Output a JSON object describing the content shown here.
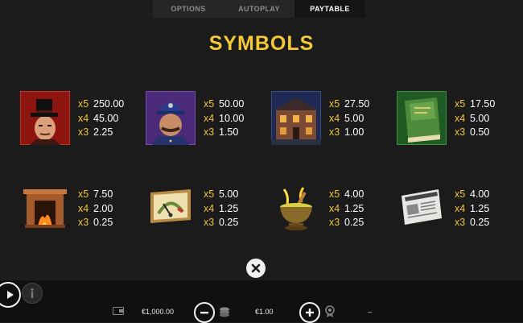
{
  "tabs": [
    {
      "label": "OPTIONS"
    },
    {
      "label": "AUTOPLAY"
    },
    {
      "label": "PAYTABLE"
    }
  ],
  "paytable": {
    "title": "SYMBOLS",
    "symbols": [
      {
        "name": "detective",
        "pays": [
          {
            "mult": "x5",
            "value": "250.00"
          },
          {
            "mult": "x4",
            "value": "45.00"
          },
          {
            "mult": "x3",
            "value": "2.25"
          }
        ]
      },
      {
        "name": "policeman",
        "pays": [
          {
            "mult": "x5",
            "value": "50.00"
          },
          {
            "mult": "x4",
            "value": "10.00"
          },
          {
            "mult": "x3",
            "value": "1.50"
          }
        ]
      },
      {
        "name": "house",
        "pays": [
          {
            "mult": "x5",
            "value": "27.50"
          },
          {
            "mult": "x4",
            "value": "5.00"
          },
          {
            "mult": "x3",
            "value": "1.00"
          }
        ]
      },
      {
        "name": "book",
        "pays": [
          {
            "mult": "x5",
            "value": "17.50"
          },
          {
            "mult": "x4",
            "value": "5.00"
          },
          {
            "mult": "x3",
            "value": "0.50"
          }
        ]
      },
      {
        "name": "fireplace",
        "pays": [
          {
            "mult": "x5",
            "value": "7.50"
          },
          {
            "mult": "x4",
            "value": "2.00"
          },
          {
            "mult": "x3",
            "value": "0.25"
          }
        ]
      },
      {
        "name": "gauge",
        "pays": [
          {
            "mult": "x5",
            "value": "5.00"
          },
          {
            "mult": "x4",
            "value": "1.25"
          },
          {
            "mult": "x3",
            "value": "0.25"
          }
        ]
      },
      {
        "name": "mortar",
        "pays": [
          {
            "mult": "x5",
            "value": "4.00"
          },
          {
            "mult": "x4",
            "value": "1.25"
          },
          {
            "mult": "x3",
            "value": "0.25"
          }
        ]
      },
      {
        "name": "newspaper",
        "pays": [
          {
            "mult": "x5",
            "value": "4.00"
          },
          {
            "mult": "x4",
            "value": "1.25"
          },
          {
            "mult": "x3",
            "value": "0.25"
          }
        ]
      }
    ]
  },
  "footer": {
    "balance": "€1,000.00",
    "bet": "€1.00",
    "win": "–"
  },
  "colors": {
    "accent": "#f5c838",
    "background": "#1b1b1b"
  }
}
